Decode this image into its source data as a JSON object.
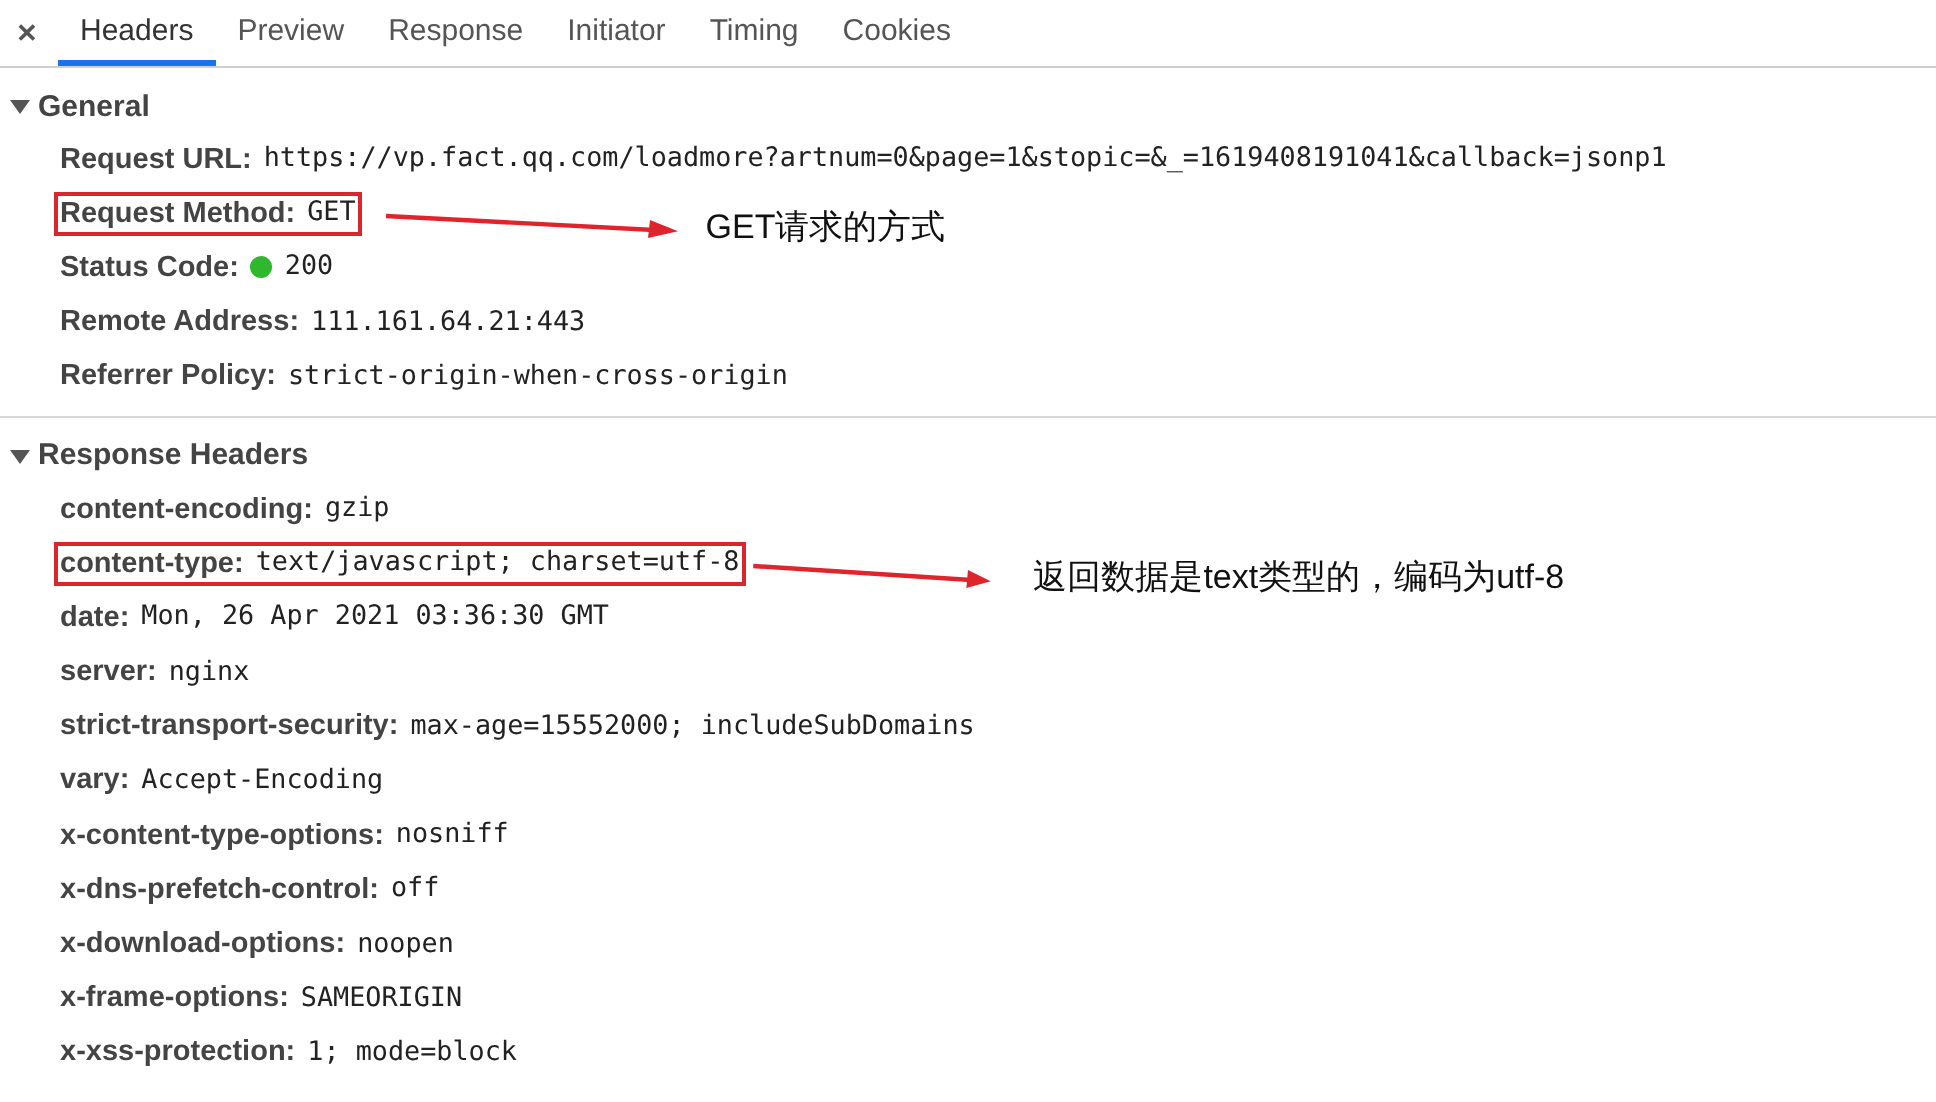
{
  "close_icon": "✕",
  "tabs": [
    {
      "label": "Headers",
      "selected": true
    },
    {
      "label": "Preview",
      "selected": false
    },
    {
      "label": "Response",
      "selected": false
    },
    {
      "label": "Initiator",
      "selected": false
    },
    {
      "label": "Timing",
      "selected": false
    },
    {
      "label": "Cookies",
      "selected": false
    }
  ],
  "sections": [
    {
      "title": "General",
      "expanded": true,
      "rows": [
        {
          "kind": "text",
          "name": "Request URL:",
          "value": "https://vp.fact.qq.com/loadmore?artnum=0&page=1&stopic=&_=1619408191041&callback=jsonp1",
          "highlighted": false
        },
        {
          "kind": "text",
          "name": "Request Method:",
          "value": "GET",
          "highlighted": true,
          "callout": "GET请求的方式"
        },
        {
          "kind": "status",
          "name": "Status Code:",
          "value": "200",
          "highlighted": false,
          "color": "#2db82d"
        },
        {
          "kind": "text",
          "name": "Remote Address:",
          "value": "111.161.64.21:443",
          "highlighted": false
        },
        {
          "kind": "text",
          "name": "Referrer Policy:",
          "value": "strict-origin-when-cross-origin",
          "highlighted": false
        }
      ]
    },
    {
      "title": "Response Headers",
      "expanded": true,
      "rows": [
        {
          "kind": "text",
          "name": "content-encoding:",
          "value": "gzip",
          "highlighted": false
        },
        {
          "kind": "text",
          "name": "content-type:",
          "value": "text/javascript; charset=utf-8",
          "highlighted": true,
          "callout": "返回数据是text类型的，编码为utf-8"
        },
        {
          "kind": "text",
          "name": "date:",
          "value": "Mon, 26 Apr 2021 03:36:30 GMT",
          "highlighted": false
        },
        {
          "kind": "text",
          "name": "server:",
          "value": "nginx",
          "highlighted": false
        },
        {
          "kind": "text",
          "name": "strict-transport-security:",
          "value": "max-age=15552000; includeSubDomains",
          "highlighted": false
        },
        {
          "kind": "text",
          "name": "vary:",
          "value": "Accept-Encoding",
          "highlighted": false
        },
        {
          "kind": "text",
          "name": "x-content-type-options:",
          "value": "nosniff",
          "highlighted": false
        },
        {
          "kind": "text",
          "name": "x-dns-prefetch-control:",
          "value": "off",
          "highlighted": false
        },
        {
          "kind": "text",
          "name": "x-download-options:",
          "value": "noopen",
          "highlighted": false
        },
        {
          "kind": "text",
          "name": "x-frame-options:",
          "value": "SAMEORIGIN",
          "highlighted": false
        },
        {
          "kind": "text",
          "name": "x-xss-protection:",
          "value": "1; mode=block",
          "highlighted": false
        }
      ]
    }
  ]
}
